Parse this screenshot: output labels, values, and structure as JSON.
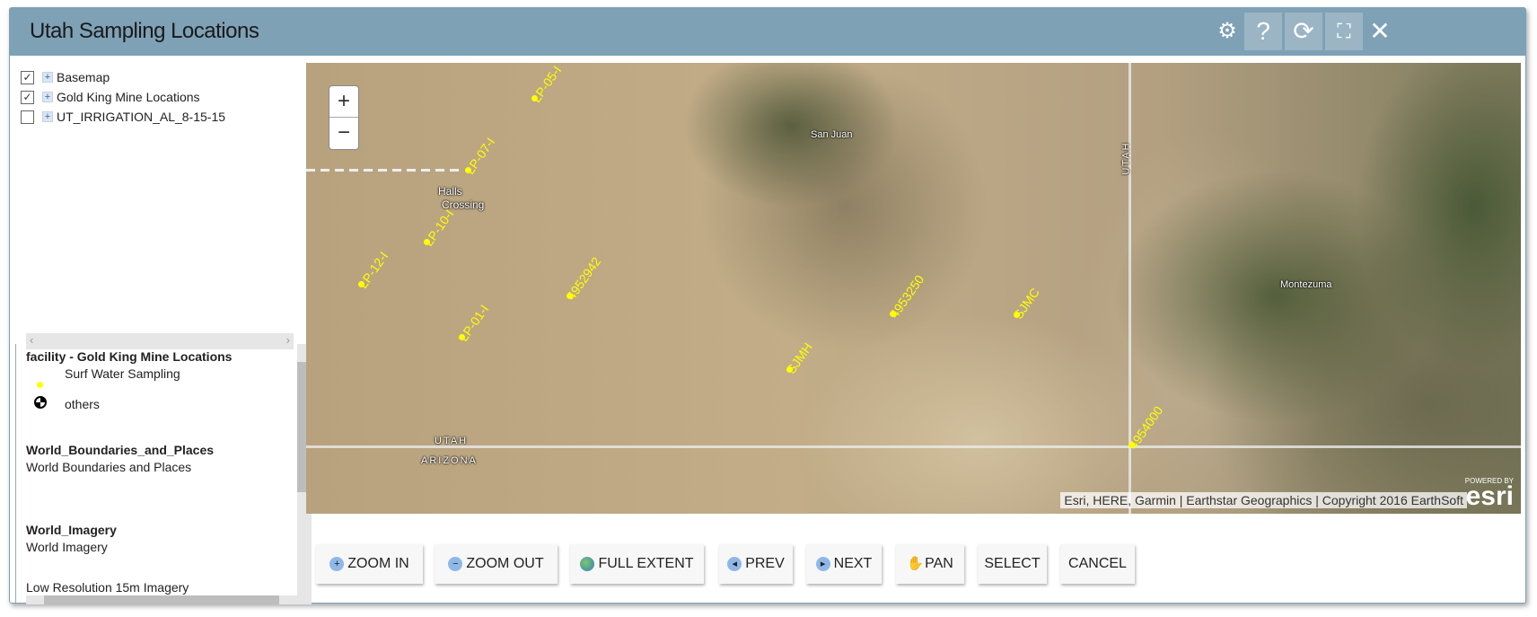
{
  "window": {
    "title": "Utah Sampling Locations",
    "header_icons": [
      "gear-icon",
      "help-icon",
      "refresh-icon",
      "fullscreen-icon",
      "close-icon"
    ]
  },
  "layers": [
    {
      "label": "Basemap",
      "checked": true
    },
    {
      "label": "Gold King Mine Locations",
      "checked": true
    },
    {
      "label": "UT_IRRIGATION_AL_8-15-15",
      "checked": false
    }
  ],
  "legend": {
    "facility_title": "facility - Gold King Mine Locations",
    "surf_water": "Surf Water Sampling",
    "others": "others",
    "wbp_title": "World_Boundaries_and_Places",
    "wbp_desc": "World Boundaries and Places",
    "wi_title": "World_Imagery",
    "wi_desc": "World Imagery",
    "low_res": "Low Resolution 15m Imagery"
  },
  "map": {
    "zoom_in": "+",
    "zoom_out": "−",
    "marker_color": "#ffff00",
    "markers": [
      "LP-05-I",
      "LP-07-I",
      "LP-10-I",
      "LP-12-I",
      "4952942",
      "LP-01-I",
      "SJMH",
      "4953250",
      "SJMC",
      "4954000"
    ],
    "places": {
      "san_juan": "San Juan",
      "halls": "Halls",
      "crossing": "Crossing",
      "montezuma": "Montezuma",
      "utah": "UTAH",
      "arizona": "ARIZONA",
      "utah_vertical": "UTAH"
    },
    "attribution": "Esri, HERE, Garmin | Earthstar Geographics | Copyright 2016 EarthSoft",
    "esri_powered": "POWERED BY",
    "esri_logo": "esri"
  },
  "toolbar": {
    "zoom_in": "ZOOM IN",
    "zoom_out": "ZOOM OUT",
    "full_extent": "FULL EXTENT",
    "prev": "PREV",
    "next": "NEXT",
    "pan": "PAN",
    "select": "SELECT",
    "cancel": "CANCEL"
  }
}
